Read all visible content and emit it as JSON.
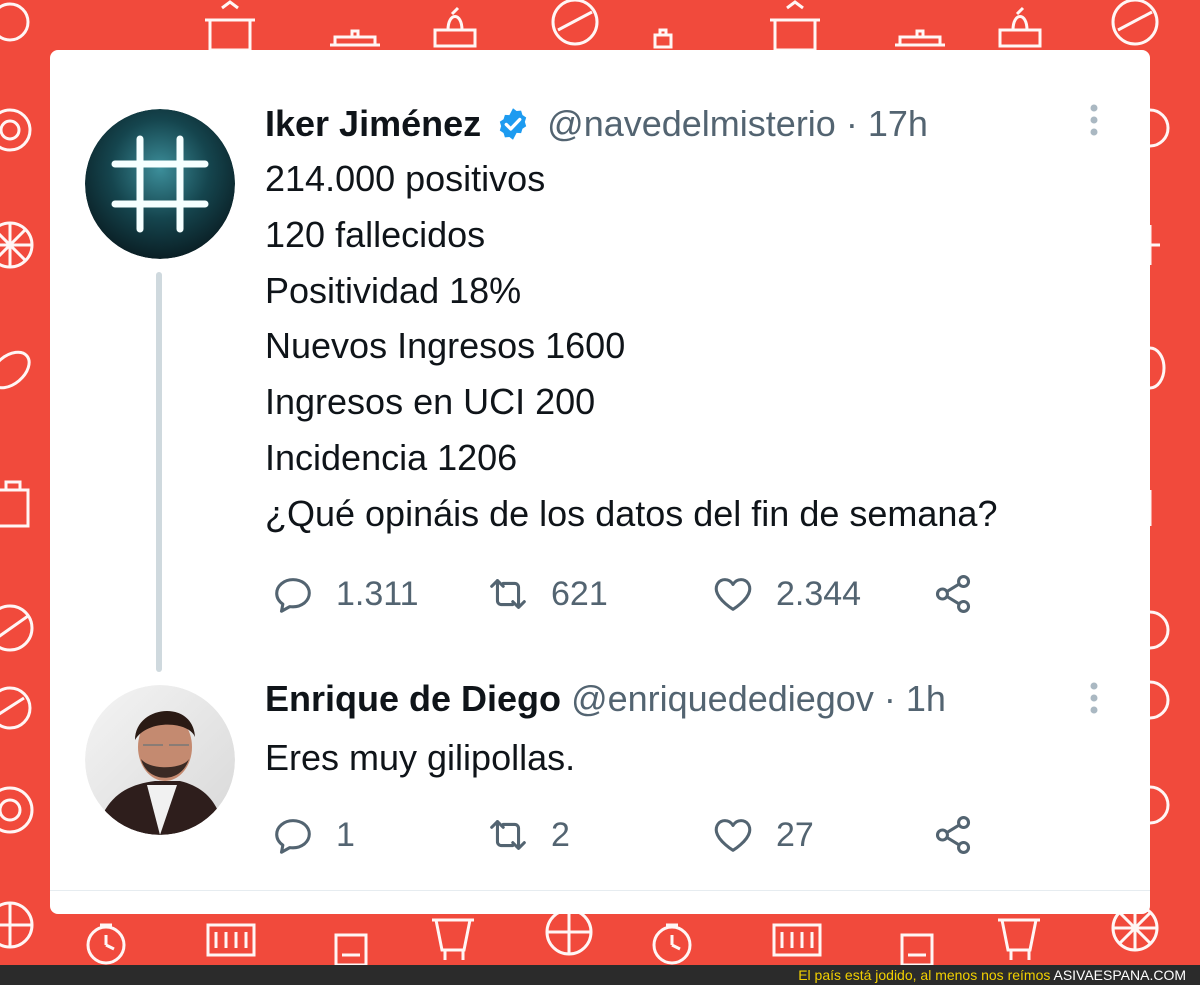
{
  "tweets": [
    {
      "name": "Iker Jiménez",
      "verified": true,
      "handle": "@navedelmisterio",
      "separator": "·",
      "time": "17h",
      "lines": [
        "214.000 positivos",
        "120 fallecidos",
        "Positividad 18%",
        "Nuevos Ingresos 1600",
        "Ingresos en UCI 200",
        "Incidencia 1206",
        "¿Qué opináis de los datos del fin de semana?"
      ],
      "replies": "1.311",
      "retweets": "621",
      "likes": "2.344"
    },
    {
      "name": "Enrique de Diego",
      "verified": false,
      "handle": "@enriquedediegov",
      "separator": "·",
      "time": "1h",
      "lines": [
        "Eres muy gilipollas."
      ],
      "replies": "1",
      "retweets": "2",
      "likes": "27"
    }
  ],
  "footer": {
    "caption": "El país está jodido, al menos nos reímos",
    "site": "ASIVAESPANA.COM"
  },
  "colors": {
    "background": "#f14a3c",
    "card": "#ffffff",
    "text": "#0f1419",
    "muted": "#536471",
    "verified": "#1d9bf0"
  },
  "icons": [
    "reply-icon",
    "retweet-icon",
    "like-icon",
    "share-icon",
    "more-icon",
    "verified-badge-icon"
  ]
}
